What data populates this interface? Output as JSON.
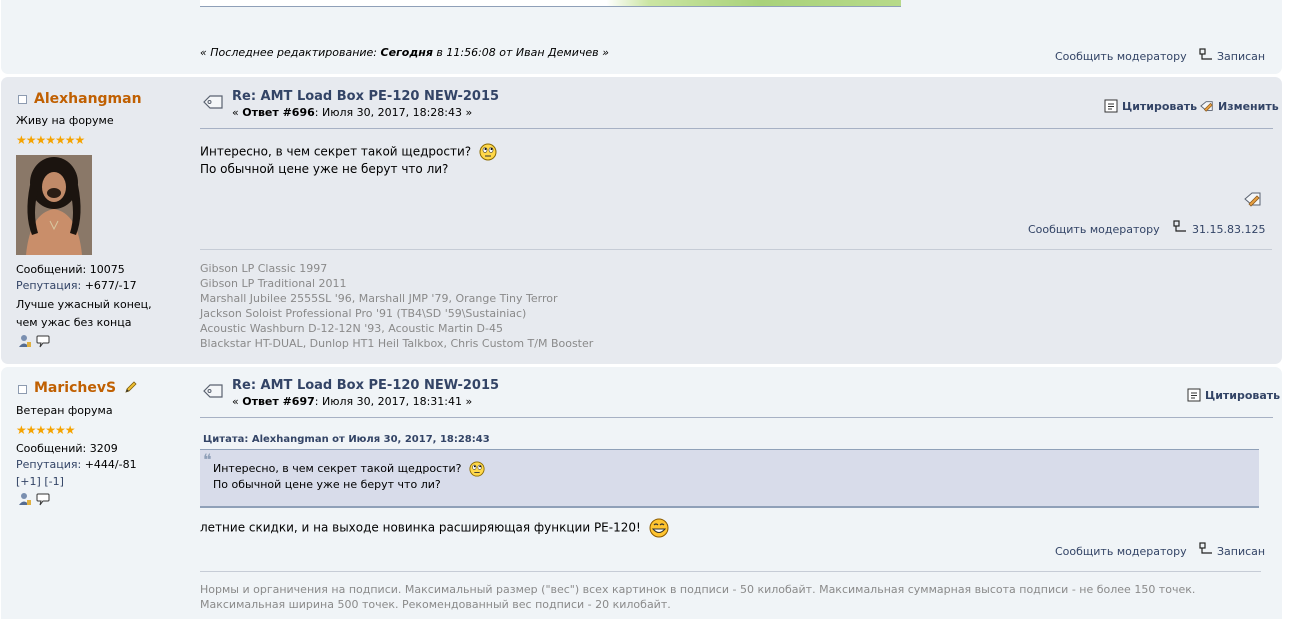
{
  "post0": {
    "edit_prefix": "« Последнее редактирование:",
    "edit_when": "Сегодня",
    "edit_time": "в 11:56:08 от Иван Демичев »",
    "report_label": "Сообщить модератору",
    "ip_label": "Записан"
  },
  "post1": {
    "author": {
      "name": "Alexhangman",
      "rank": "Живу на форуме",
      "stars": "★★★★★★★",
      "posts_label": "Сообщений:",
      "posts_value": "10075",
      "rep_label": "Репутация:",
      "rep_value": "+677/-17",
      "motto_line1": "Лучше ужасный конец,",
      "motto_line2": "чем ужас без конца"
    },
    "subject": "Re: AMT Load Box PE-120 NEW-2015",
    "reply_label": "Ответ #696",
    "date": ": Июля 30, 2017, 18:28:43 »",
    "quote_button": "Цитировать",
    "edit_button": "Изменить",
    "body_line1": "Интересно, в чем секрет такой щедрости?",
    "body_line2": "По обычной цене уже не берут что ли?",
    "report_label": "Сообщить модератору",
    "ip_value": "31.15.83.125",
    "signature": [
      "Gibson LP Classic 1997",
      "Gibson LP Traditional 2011",
      "Marshall Jubilee 2555SL '96, Marshall JMP '79, Orange Tiny Terror",
      "Jackson Soloist Professional Pro '91 (TB4\\SD '59\\Sustainiac)",
      "Acoustic Washburn D-12-12N '93, Acoustic Martin D-45",
      "Blackstar HT-DUAL, Dunlop HT1 Heil Talkbox, Chris Custom T/M Booster"
    ]
  },
  "post2": {
    "author": {
      "name": "MarichevS",
      "rank": "Ветеран форума",
      "stars": "★★★★★★",
      "posts_label": "Сообщений:",
      "posts_value": "3209",
      "rep_label": "Репутация:",
      "rep_value": "+444/-81",
      "plus_label": "[+1]",
      "minus_label": "[-1]"
    },
    "subject": "Re: AMT Load Box PE-120 NEW-2015",
    "reply_label": "Ответ #697",
    "date": ": Июля 30, 2017, 18:31:41 »",
    "quote_button": "Цитировать",
    "quote_header": "Цитата: Alexhangman от Июля 30, 2017, 18:28:43",
    "quote_line1": "Интересно, в чем секрет такой щедрости?",
    "quote_line2": "По обычной цене уже не берут что ли?",
    "body_line1": "летние скидки, и на выходе новинка расширяющая функции PE-120!",
    "report_label": "Сообщить модератору",
    "ip_label": "Записан",
    "signature": [
      "Нормы и органичения на подписи. Максимальный размер (\"вес\") всех картинок в подписи - 50 килобайт. Максимальная суммарная высота подписи - не более 150 точек.",
      "Максимальная ширина 500 точек. Рекомендованный вес подписи - 20 килобайт."
    ]
  },
  "colors": {
    "author": "#c06002",
    "link": "#334466",
    "post_grey": "#e7eaef",
    "post_light": "#f0f4f7",
    "signature": "#8a8a8a"
  },
  "icons": [
    "topic-icon",
    "quote-icon",
    "modify-icon",
    "ip-icon",
    "profile-icon",
    "pm-icon",
    "pencil-icon",
    "smiley-rolleyes",
    "smiley-grin",
    "online-status-icon"
  ]
}
